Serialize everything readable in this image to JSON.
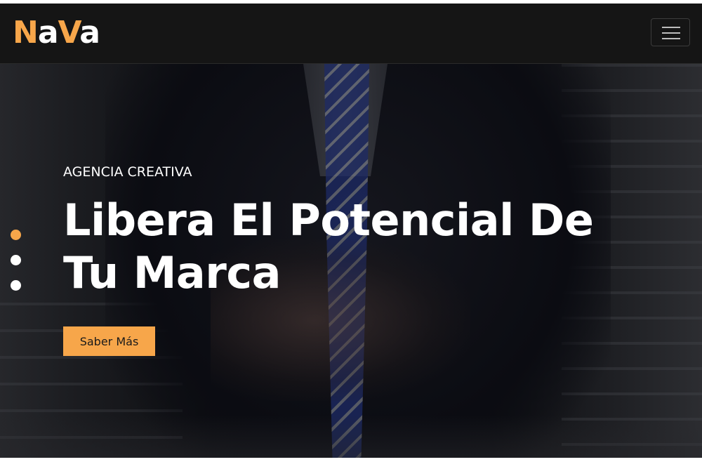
{
  "navbar": {
    "logo": {
      "part1": "N",
      "part2": "a",
      "part3": "V",
      "part4": "a"
    },
    "menu_icon": "hamburger-menu-icon"
  },
  "hero": {
    "eyebrow": "AGENCIA CREATIVA",
    "headline": "Libera El Potencial De Tu Marca",
    "cta_label": "Saber Más",
    "slides": [
      {
        "active": true
      },
      {
        "active": false
      },
      {
        "active": false
      }
    ]
  },
  "colors": {
    "accent": "#f7a64a",
    "navbar_bg": "#151515",
    "text_light": "#ffffff"
  }
}
